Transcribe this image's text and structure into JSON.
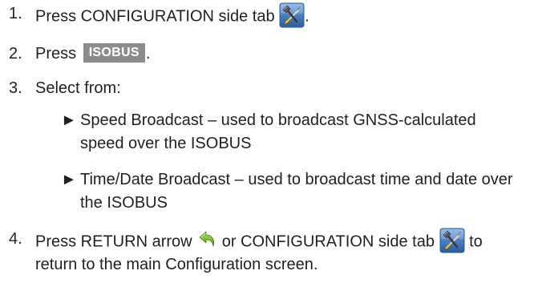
{
  "steps": [
    {
      "number": "1.",
      "text_before": "Press CONFIGURATION side tab",
      "text_after": ".",
      "icon": "tools-icon"
    },
    {
      "number": "2.",
      "text_before": "Press",
      "button_label": "ISOBUS",
      "text_after": "."
    },
    {
      "number": "3.",
      "text": "Select from:",
      "options": [
        {
          "marker": "►",
          "line1": "Speed Broadcast – used to broadcast GNSS-calculated",
          "line2": "speed over the ISOBUS"
        },
        {
          "marker": "►",
          "line1": "Time/Date Broadcast – used to broadcast time and date over",
          "line2": "the ISOBUS"
        }
      ]
    },
    {
      "number": "4.",
      "text_before": "Press RETURN arrow",
      "text_middle": "or CONFIGURATION side tab",
      "text_after": "to",
      "line2": "return to the main Configuration screen.",
      "icons": [
        "return-arrow-icon",
        "tools-icon"
      ]
    }
  ],
  "colors": {
    "text": "#231f20",
    "button_bg": "#8c8c8c",
    "button_text": "#ffffff",
    "icon_tile": "#4a7fc1",
    "return_arrow": "#7bc043"
  }
}
